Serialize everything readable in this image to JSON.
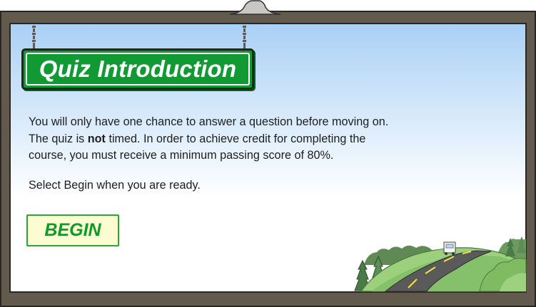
{
  "header": {
    "title": "Quiz Introduction"
  },
  "intro": {
    "line1": "You will only have one chance to answer a question before moving on.",
    "line2_before": "The quiz is ",
    "line2_bold": "not",
    "line2_after": " timed. In order to achieve credit for completing the",
    "line3": "course, you must receive a minimum passing score of 80%.",
    "prompt": "Select Begin when you are ready."
  },
  "actions": {
    "begin_label": "BEGIN"
  },
  "colors": {
    "sign_green": "#119933",
    "frame_brown": "#625a4c",
    "sky_top": "#a9d0f5",
    "button_bg": "#fbfcd2",
    "button_text": "#0f9a2a"
  }
}
